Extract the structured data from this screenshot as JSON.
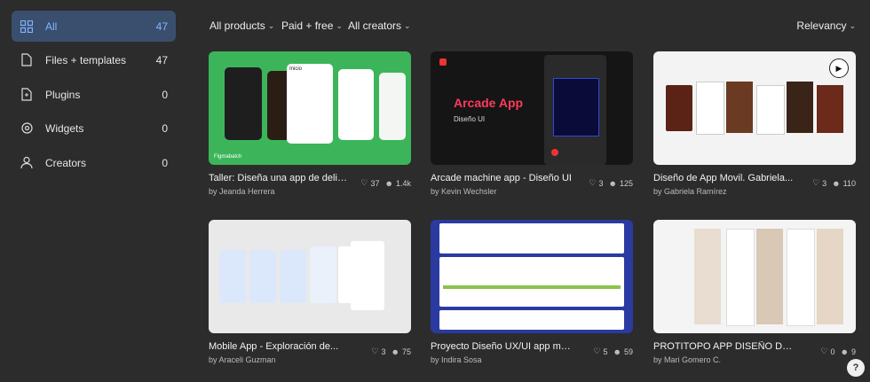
{
  "sidebar": {
    "items": [
      {
        "label": "All",
        "count": "47"
      },
      {
        "label": "Files + templates",
        "count": "47"
      },
      {
        "label": "Plugins",
        "count": "0"
      },
      {
        "label": "Widgets",
        "count": "0"
      },
      {
        "label": "Creators",
        "count": "0"
      }
    ]
  },
  "filters": {
    "products": "All products",
    "price": "Paid + free",
    "creators": "All creators",
    "sort": "Relevancy"
  },
  "cards": [
    {
      "title": "Taller: Diseña una app de deliver...",
      "author": "by Jeanda Herrera",
      "likes": "37",
      "users": "1.4k",
      "thumb_text": "Inicio",
      "brand": "Figmabatch"
    },
    {
      "title": "Arcade machine app - Diseño UI",
      "author": "by Kevin Wechsler",
      "likes": "3",
      "users": "125",
      "thumb_text": "Arcade App",
      "thumb_sub": "Diseño UI"
    },
    {
      "title": "Diseño de App Movil. Gabriela...",
      "author": "by Gabriela Ramírez",
      "likes": "3",
      "users": "110"
    },
    {
      "title": "Mobile App - Exploración de...",
      "author": "by Araceli Guzman",
      "likes": "3",
      "users": "75"
    },
    {
      "title": "Proyecto Diseño UX/UI app móbil...",
      "author": "by Indira Sosa",
      "likes": "5",
      "users": "59"
    },
    {
      "title": "PROTITOPO APP DISEÑO DE...",
      "author": "by Mari Gomero C.",
      "likes": "0",
      "users": "9"
    }
  ],
  "colors": {
    "active_bg": "#3a4f6e",
    "accent": "#7eb6ff",
    "bg": "#2c2c2c"
  }
}
